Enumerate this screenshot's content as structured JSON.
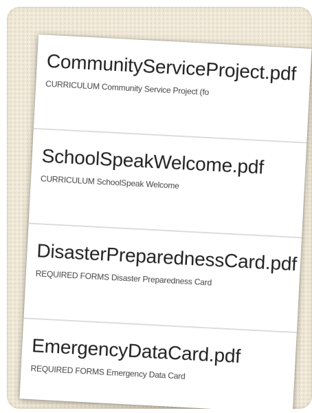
{
  "files": [
    {
      "name": "CommunityServiceProject.pdf",
      "description": "CURRICULUM Community Service Project (fo"
    },
    {
      "name": "SchoolSpeakWelcome.pdf",
      "description": "CURRICULUM SchoolSpeak Welcome"
    },
    {
      "name": "DisasterPreparednessCard.pdf",
      "description": "REQUIRED FORMS Disaster Preparedness Card"
    },
    {
      "name": "EmergencyDataCard.pdf",
      "description": "REQUIRED FORMS Emergency Data Card"
    }
  ]
}
